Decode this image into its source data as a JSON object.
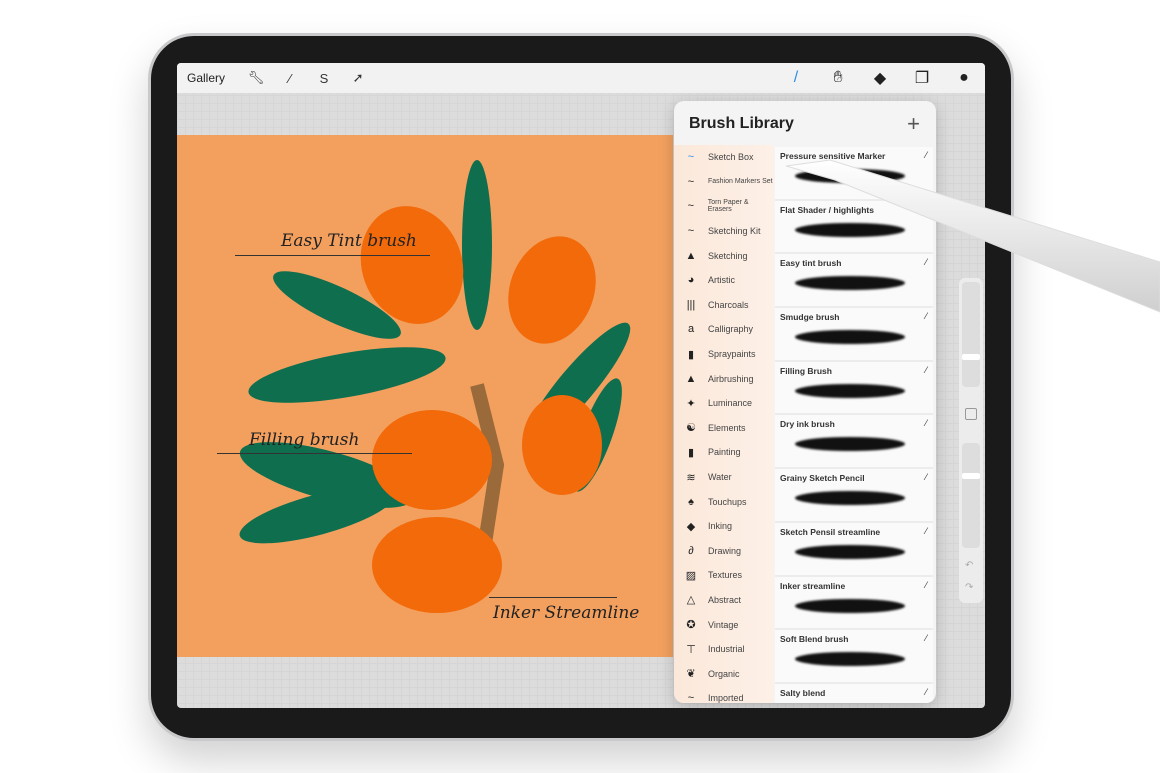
{
  "toolbar": {
    "gallery": "Gallery",
    "left_icons": [
      "wrench-icon",
      "magic-wand-icon",
      "selection-s-icon",
      "arrow-transform-icon"
    ],
    "right_icons": [
      "brush-icon",
      "smudge-icon",
      "eraser-icon",
      "layers-icon",
      "color-icon"
    ],
    "accent": "#2f8fe8"
  },
  "artwork": {
    "annotations": [
      "Easy Tint brush",
      "Filling brush",
      "Inker Streamline"
    ],
    "background": "#f3a05f"
  },
  "brush_library": {
    "title": "Brush Library",
    "add": "+",
    "sets": [
      {
        "label": "Sketch Box",
        "icon": "~"
      },
      {
        "label": "Fashion Markers Set",
        "icon": "~"
      },
      {
        "label": "Torn Paper & Erasers",
        "icon": "~"
      },
      {
        "label": "Sketching Kit",
        "icon": "~"
      },
      {
        "label": "Sketching",
        "icon": "▲"
      },
      {
        "label": "Artistic",
        "icon": "◕"
      },
      {
        "label": "Charcoals",
        "icon": "|||"
      },
      {
        "label": "Calligraphy",
        "icon": "a"
      },
      {
        "label": "Spraypaints",
        "icon": "▮"
      },
      {
        "label": "Airbrushing",
        "icon": "▲"
      },
      {
        "label": "Luminance",
        "icon": "✦"
      },
      {
        "label": "Elements",
        "icon": "☯"
      },
      {
        "label": "Painting",
        "icon": "▮"
      },
      {
        "label": "Water",
        "icon": "≋"
      },
      {
        "label": "Touchups",
        "icon": "♠"
      },
      {
        "label": "Inking",
        "icon": "◆"
      },
      {
        "label": "Drawing",
        "icon": "∂"
      },
      {
        "label": "Textures",
        "icon": "▨"
      },
      {
        "label": "Abstract",
        "icon": "△"
      },
      {
        "label": "Vintage",
        "icon": "✪"
      },
      {
        "label": "Industrial",
        "icon": "⊤"
      },
      {
        "label": "Organic",
        "icon": "❦"
      },
      {
        "label": "Imported",
        "icon": "~"
      }
    ],
    "brushes": [
      "Pressure sensitive Marker",
      "Flat Shader / highlights",
      "Easy tint brush",
      "Smudge brush",
      "Filling Brush",
      "Dry ink brush",
      "Grainy Sketch Pencil",
      "Sketch Pensil streamline",
      "Inker streamline",
      "Soft Blend brush",
      "Salty blend"
    ]
  }
}
